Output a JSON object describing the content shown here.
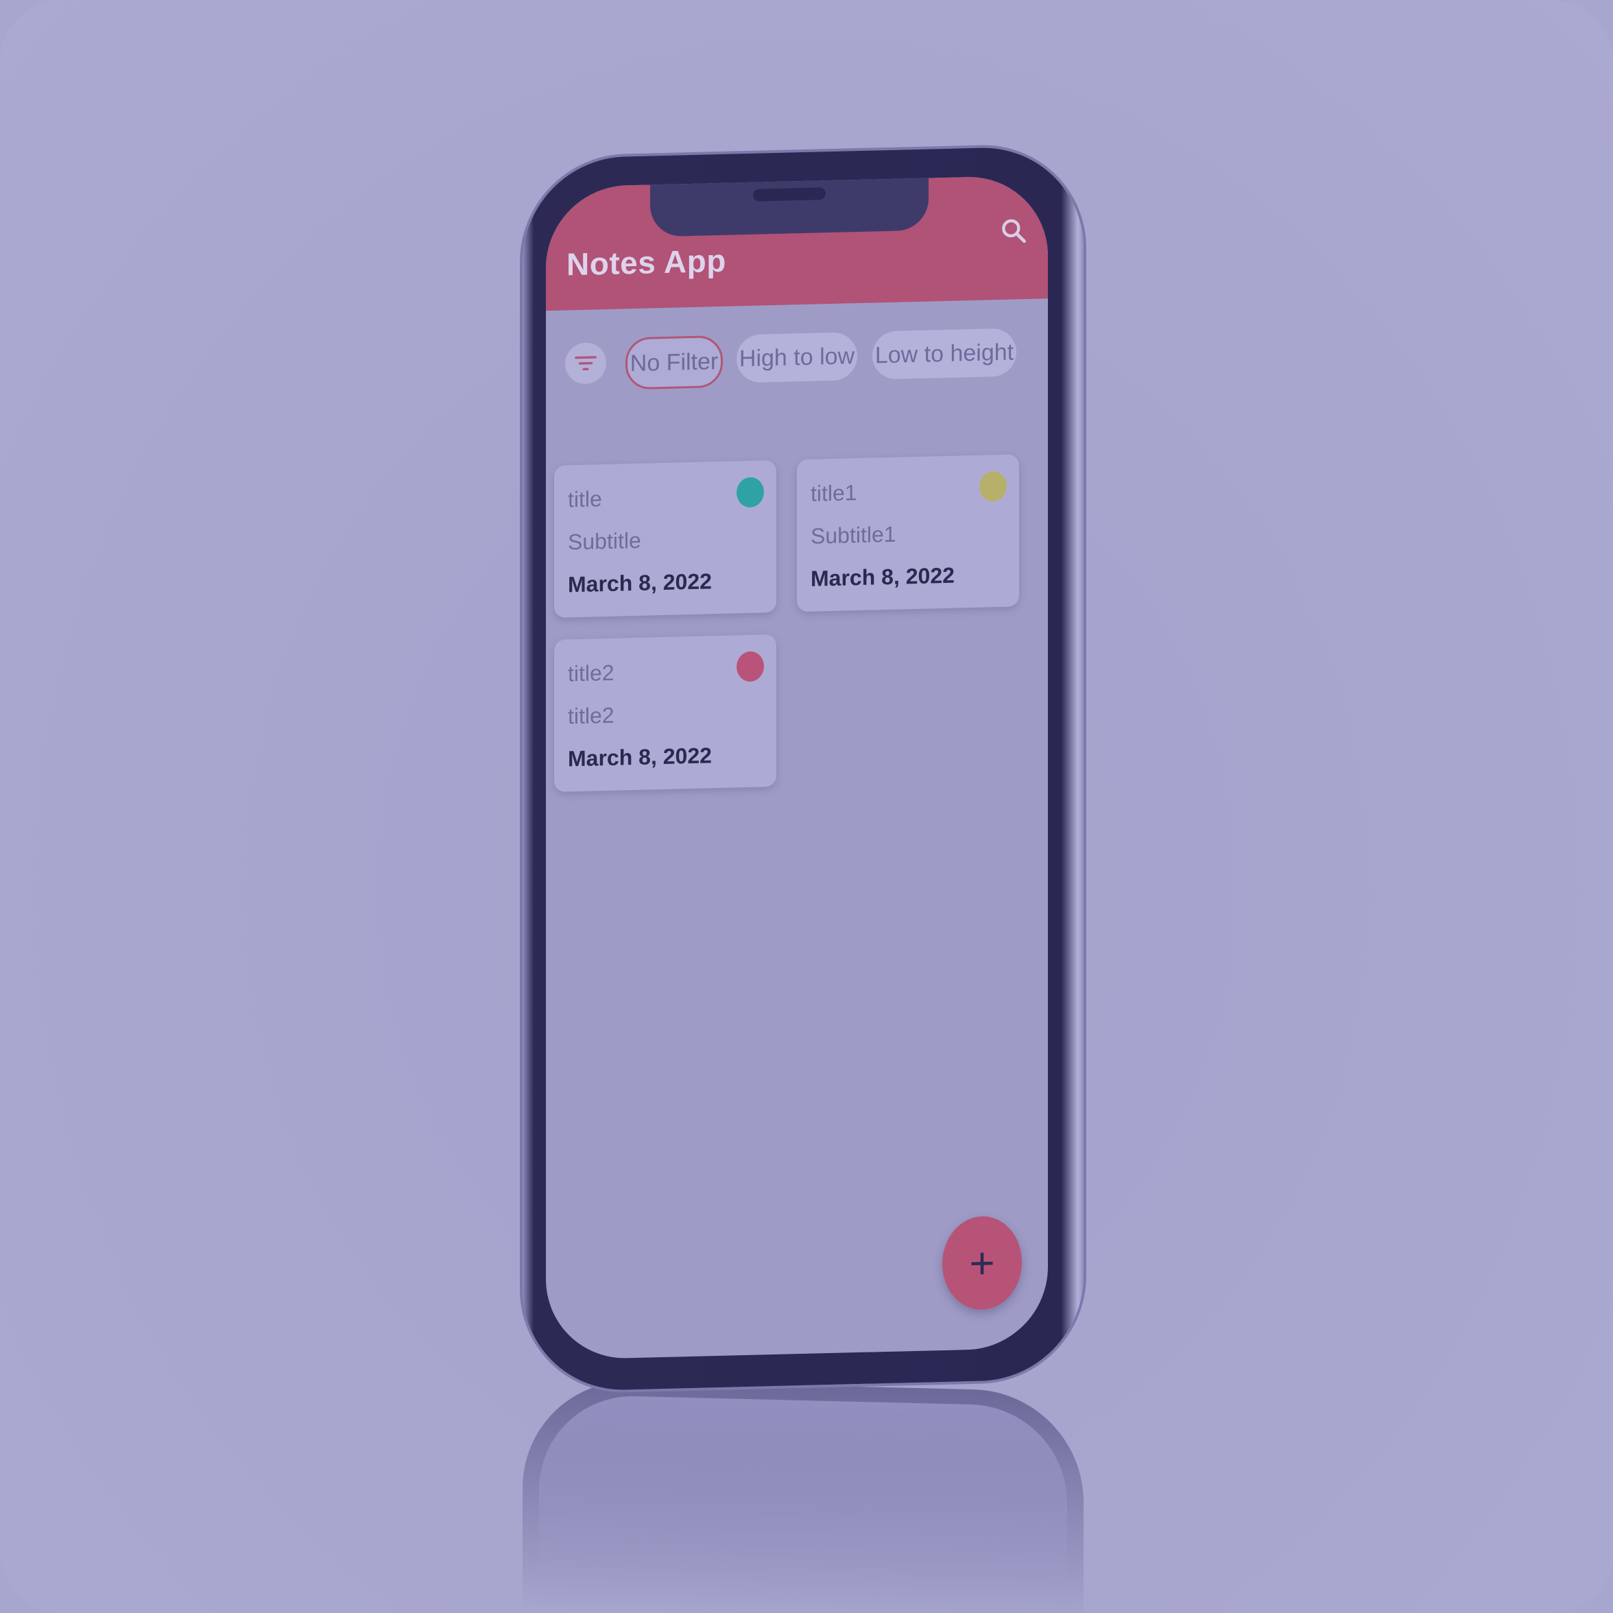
{
  "app": {
    "title": "Notes App"
  },
  "header": {
    "search_icon": "search-icon"
  },
  "filters": {
    "icon": "filter-icon",
    "chips": [
      {
        "label": "No Filter",
        "active": true
      },
      {
        "label": "High to low",
        "active": false
      },
      {
        "label": "Low to height",
        "active": false
      }
    ]
  },
  "notes": [
    {
      "title": "title",
      "subtitle": "Subtitle",
      "date": "March 8, 2022",
      "color": "#2fa2a6"
    },
    {
      "title": "title1",
      "subtitle": "Subtitle1",
      "date": "March 8, 2022",
      "color": "#b7b06a"
    },
    {
      "title": "title2",
      "subtitle": "title2",
      "date": "March 8, 2022",
      "color": "#b9537a"
    }
  ],
  "fab": {
    "label": "+",
    "icon": "plus-icon"
  },
  "colors": {
    "appbar": "#b15277",
    "accent": "#b85378",
    "background": "#a7a6ce"
  }
}
